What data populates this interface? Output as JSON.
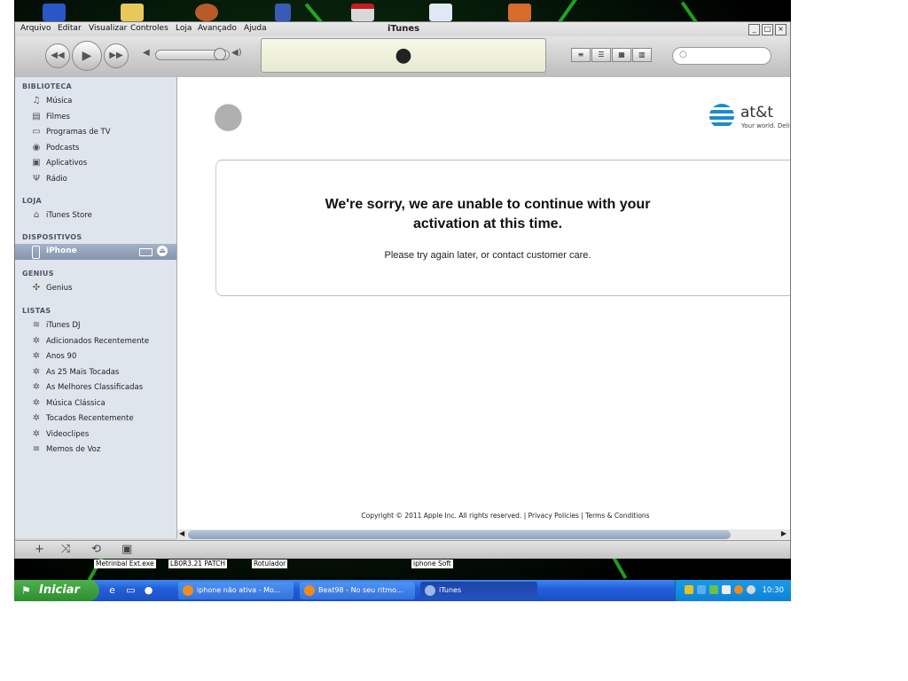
{
  "window": {
    "title": "iTunes"
  },
  "menu": [
    "Arquivo",
    "Editar",
    "Visualizar",
    "Controles",
    "Loja",
    "Avançado",
    "Ajuda"
  ],
  "sidebar": {
    "library": {
      "header": "BIBLIOTECA",
      "items": [
        "Música",
        "Filmes",
        "Programas de TV",
        "Podcasts",
        "Aplicativos",
        "Rádio"
      ]
    },
    "store": {
      "header": "LOJA",
      "items": [
        "iTunes Store"
      ]
    },
    "devices": {
      "header": "DISPOSITIVOS",
      "items": [
        "iPhone"
      ]
    },
    "genius": {
      "header": "GENIUS",
      "items": [
        "Genius"
      ]
    },
    "playlists": {
      "header": "LISTAS",
      "items": [
        "iTunes DJ",
        "Adicionados Recentemente",
        "Anos 90",
        "As 25 Mais Tocadas",
        "As Melhores Classificadas",
        "Música Clássica",
        "Tocados Recentemente",
        "Videoclipes",
        "Memos de Voz"
      ]
    }
  },
  "content": {
    "att_name": "at&t",
    "att_tagline": "Your world. Delivered",
    "message_heading": "We're sorry, we are unable to continue with your activation at this time.",
    "message_sub": "Please try again later, or contact customer care.",
    "footer": "Copyright © 2011 Apple Inc. All rights reserved. | Privacy Policies | Terms & Conditions"
  },
  "desktop_labels": [
    "Metrinbal Ext.exe",
    "LB0R3.21 PATCH",
    "Rotulador",
    "iphone Soft"
  ],
  "taskbar": {
    "start_label": "Iniciar",
    "tasks": [
      "iphone não ativa - Mo...",
      "Beat98 - No seu ritmo...",
      "iTunes"
    ],
    "clock": "10:30"
  },
  "colors": {
    "taskbar_blue": "#245edb",
    "start_green": "#3a9b3a",
    "selection_blue": "#8594ad",
    "att_blue": "#1a8ccc"
  }
}
